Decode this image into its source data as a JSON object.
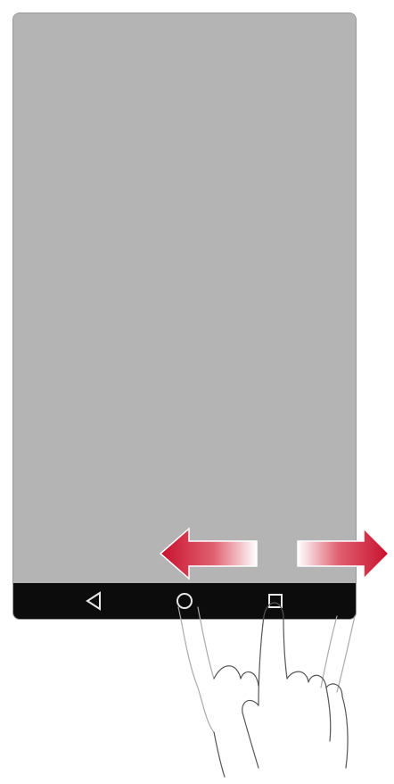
{
  "device": {
    "navbar": {
      "buttons": [
        {
          "icon": "back-icon"
        },
        {
          "icon": "home-icon"
        },
        {
          "icon": "recents-icon"
        }
      ]
    }
  },
  "gesture": {
    "type": "swipe-left-right",
    "arrow_color": "#c8102e",
    "arrow_fade_color": "#ffffff"
  },
  "colors": {
    "screen": "#b4b4b4",
    "navbar": "#0c0c0c",
    "nav_icon": "#e8e8e8"
  }
}
